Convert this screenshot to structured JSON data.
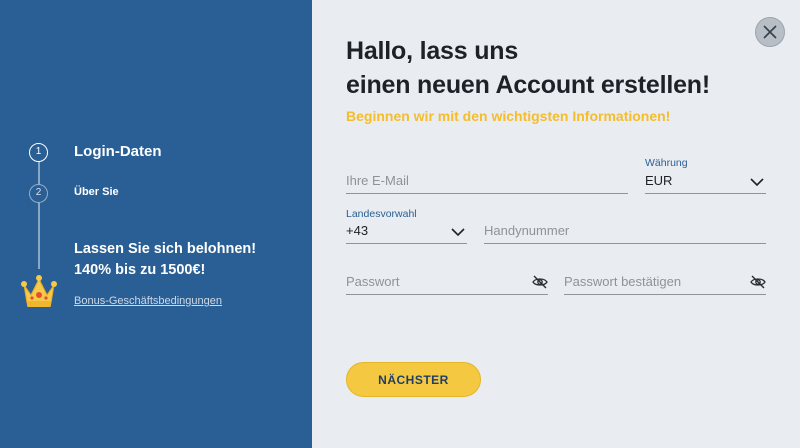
{
  "sidebar": {
    "steps": [
      {
        "number": "1",
        "label": "Login-Daten"
      },
      {
        "number": "2",
        "label": "Über Sie"
      }
    ],
    "bonus": {
      "line1": "Lassen Sie sich belohnen!",
      "line2": "140% bis zu 1500€!",
      "link": "Bonus-Geschäftsbedingungen"
    }
  },
  "form": {
    "title_line1": "Hallo, lass uns",
    "title_line2": "einen neuen Account erstellen!",
    "subtitle": "Beginnen wir mit den wichtigsten Informationen!",
    "email": {
      "placeholder": "Ihre E-Mail"
    },
    "currency": {
      "label": "Währung",
      "value": "EUR"
    },
    "country_code": {
      "label": "Landesvorwahl",
      "value": "+43"
    },
    "phone": {
      "placeholder": "Handynummer"
    },
    "password": {
      "placeholder": "Passwort"
    },
    "password_confirm": {
      "placeholder": "Passwort bestätigen"
    },
    "next_button": "NÄCHSTER"
  },
  "icons": {
    "close": "close-icon",
    "crown": "crown-icon",
    "chevron": "chevron-down-icon",
    "eye": "eye-off-icon"
  },
  "colors": {
    "sidebar_bg": "#2a5f95",
    "accent_yellow": "#f5c842",
    "subtitle_yellow": "#f5bd2c",
    "form_bg": "#e9ecf0"
  }
}
